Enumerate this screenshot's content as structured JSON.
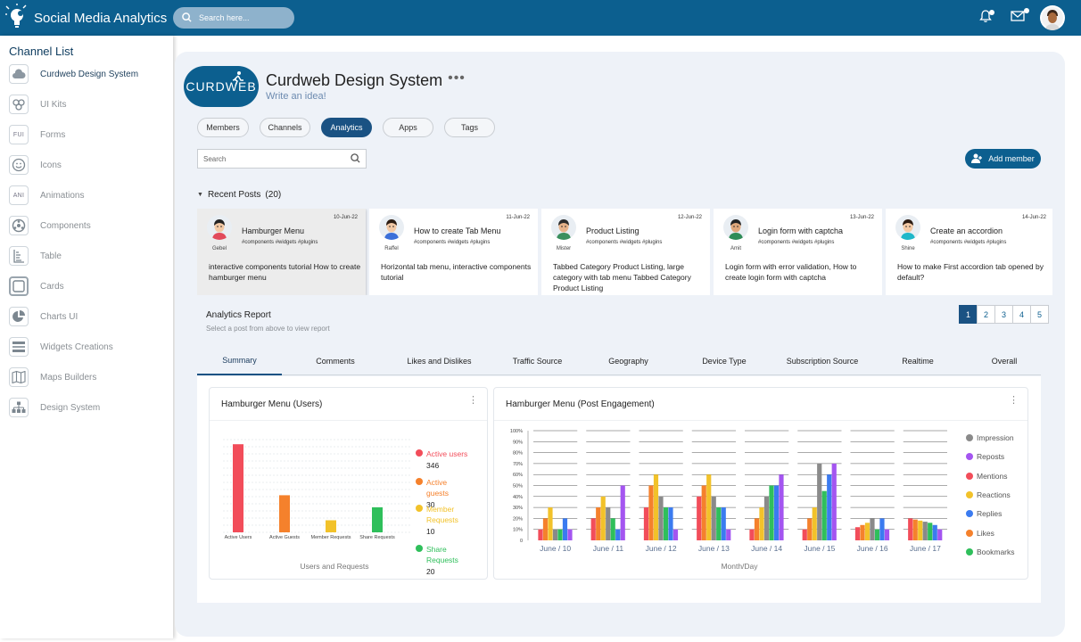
{
  "app": {
    "title": "Social Media Analytics"
  },
  "search": {
    "placeholder": "Search here..."
  },
  "sidebar": {
    "title": "Channel List",
    "items": [
      {
        "label": "Curdweb Design System",
        "icon": "cloud-icon",
        "active": true
      },
      {
        "label": "UI Kits",
        "icon": "puzzle-icon"
      },
      {
        "label": "Forms",
        "icon": "forms-icon",
        "text": "FUI"
      },
      {
        "label": "Icons",
        "icon": "smile-icon"
      },
      {
        "label": "Animations",
        "icon": "animations-icon",
        "text": "ANI"
      },
      {
        "label": "Components",
        "icon": "components-icon"
      },
      {
        "label": "Table",
        "icon": "table-icon"
      },
      {
        "label": "Cards",
        "icon": "cards-icon"
      },
      {
        "label": "Charts UI",
        "icon": "pie-chart-icon"
      },
      {
        "label": "Widgets Creations",
        "icon": "widgets-icon"
      },
      {
        "label": "Maps Builders",
        "icon": "map-icon"
      },
      {
        "label": "Design System",
        "icon": "sitemap-icon"
      }
    ]
  },
  "header": {
    "logo_text": "CURDWEB",
    "title": "Curdweb Design System",
    "dots": "•••",
    "subtitle": "Write an idea!"
  },
  "tabs": [
    {
      "label": "Members"
    },
    {
      "label": "Channels"
    },
    {
      "label": "Analytics",
      "active": true
    },
    {
      "label": "Apps"
    },
    {
      "label": "Tags"
    }
  ],
  "member_search": {
    "placeholder": "Search"
  },
  "add_member_label": "Add member",
  "recent_posts": {
    "label": "Recent Posts",
    "count": "(20)"
  },
  "posts": [
    {
      "date": "10-Jun-22",
      "author": "Gebel",
      "title": "Hamburger Menu",
      "tags": "#components  #widgets  #plugins",
      "desc": "interactive components tutorial How to create hamburger menu",
      "selected": true
    },
    {
      "date": "11-Jun-22",
      "author": "Raffel",
      "title": "How to create Tab Menu",
      "tags": "#components  #widgets  #plugins",
      "desc": "Horizontal tab menu, interactive components tutorial"
    },
    {
      "date": "12-Jun-22",
      "author": "Mister",
      "title": "Product Listing",
      "tags": "#components  #widgets  #plugins",
      "desc": "Tabbed Category Product Listing,  large category with tab menu Tabbed Category Product Listing"
    },
    {
      "date": "13-Jun-22",
      "author": "Amit",
      "title": "Login form with captcha",
      "tags": "#components  #widgets  #plugins",
      "desc": "Login form with error validation, How to create login form with captcha"
    },
    {
      "date": "14-Jun-22",
      "author": "Shine",
      "title": "Create an accordion",
      "tags": "#components  #widgets  #plugins",
      "desc": "How to make First accordion tab opened by default?"
    }
  ],
  "analytics": {
    "title": "Analytics Report",
    "subtitle": "Select a post from above to view report"
  },
  "pagination": [
    "1",
    "2",
    "3",
    "4",
    "5"
  ],
  "report_tabs": [
    "Summary",
    "Comments",
    "Likes and Dislikes",
    "Traffic Source",
    "Geography",
    "Device Type",
    "Subscription Source",
    "Realtime",
    "Overall"
  ],
  "colors": {
    "primary": "#0c5f8f",
    "red": "#f24d5a",
    "orange": "#f5812c",
    "yellow": "#f2c22a",
    "green": "#2fbf5b",
    "gray": "#8a8a8a",
    "purple": "#a455f0",
    "blue": "#3b7bf0"
  },
  "chart_data": [
    {
      "type": "bar",
      "title": "Hamburger Menu (Users)",
      "xlabel": "Users and Requests",
      "categories": [
        "Active Users",
        "Active Guests",
        "Member Requests",
        "Share Requests"
      ],
      "values": [
        346,
        30,
        10,
        20
      ],
      "bar_heights_pct": [
        95,
        40,
        13,
        27
      ],
      "colors": [
        "#f24d5a",
        "#f5812c",
        "#f2c22a",
        "#2fbf5b"
      ],
      "legend": [
        {
          "name": "Active users",
          "value": "346",
          "color": "#f24d5a"
        },
        {
          "name": "Active guests",
          "value": "30",
          "color": "#f5812c"
        },
        {
          "name": "Member Requests",
          "value": "10",
          "color": "#f2c22a"
        },
        {
          "name": "Share Requests",
          "value": "20",
          "color": "#2fbf5b"
        }
      ]
    },
    {
      "type": "bar",
      "title": "Hamburger Menu (Post Engagement)",
      "xlabel": "Month/Day",
      "categories": [
        "June / 10",
        "June / 11",
        "June / 12",
        "June / 13",
        "June / 14",
        "June / 15",
        "June / 16",
        "June / 17"
      ],
      "yticks": [
        "0",
        "10%",
        "20%",
        "30%",
        "40%",
        "50%",
        "60%",
        "70%",
        "80%",
        "90%",
        "100%"
      ],
      "ylim": [
        0,
        100
      ],
      "series": [
        {
          "name": "Mentions",
          "color": "#f24d5a",
          "values": [
            10,
            20,
            30,
            40,
            10,
            10,
            12,
            20
          ]
        },
        {
          "name": "Likes",
          "color": "#f5812c",
          "values": [
            20,
            30,
            50,
            50,
            20,
            20,
            14,
            19
          ]
        },
        {
          "name": "Reactions",
          "color": "#f2c22a",
          "values": [
            30,
            40,
            60,
            60,
            30,
            30,
            16,
            18
          ]
        },
        {
          "name": "Impression",
          "color": "#8a8a8a",
          "values": [
            10,
            30,
            40,
            40,
            40,
            70,
            20,
            17
          ]
        },
        {
          "name": "Bookmarks",
          "color": "#2fbf5b",
          "values": [
            10,
            20,
            30,
            30,
            50,
            45,
            10,
            16
          ]
        },
        {
          "name": "Replies",
          "color": "#3b7bf0",
          "values": [
            20,
            10,
            30,
            30,
            50,
            60,
            20,
            14
          ]
        },
        {
          "name": "Reposts",
          "color": "#a455f0",
          "values": [
            10,
            50,
            10,
            10,
            60,
            70,
            10,
            10
          ]
        }
      ],
      "legend": [
        {
          "name": "Impression",
          "color": "#8a8a8a"
        },
        {
          "name": "Reposts",
          "color": "#a455f0"
        },
        {
          "name": "Mentions",
          "color": "#f24d5a"
        },
        {
          "name": "Reactions",
          "color": "#f2c22a"
        },
        {
          "name": "Replies",
          "color": "#3b7bf0"
        },
        {
          "name": "Likes",
          "color": "#f5812c"
        },
        {
          "name": "Bookmarks",
          "color": "#2fbf5b"
        }
      ]
    }
  ]
}
